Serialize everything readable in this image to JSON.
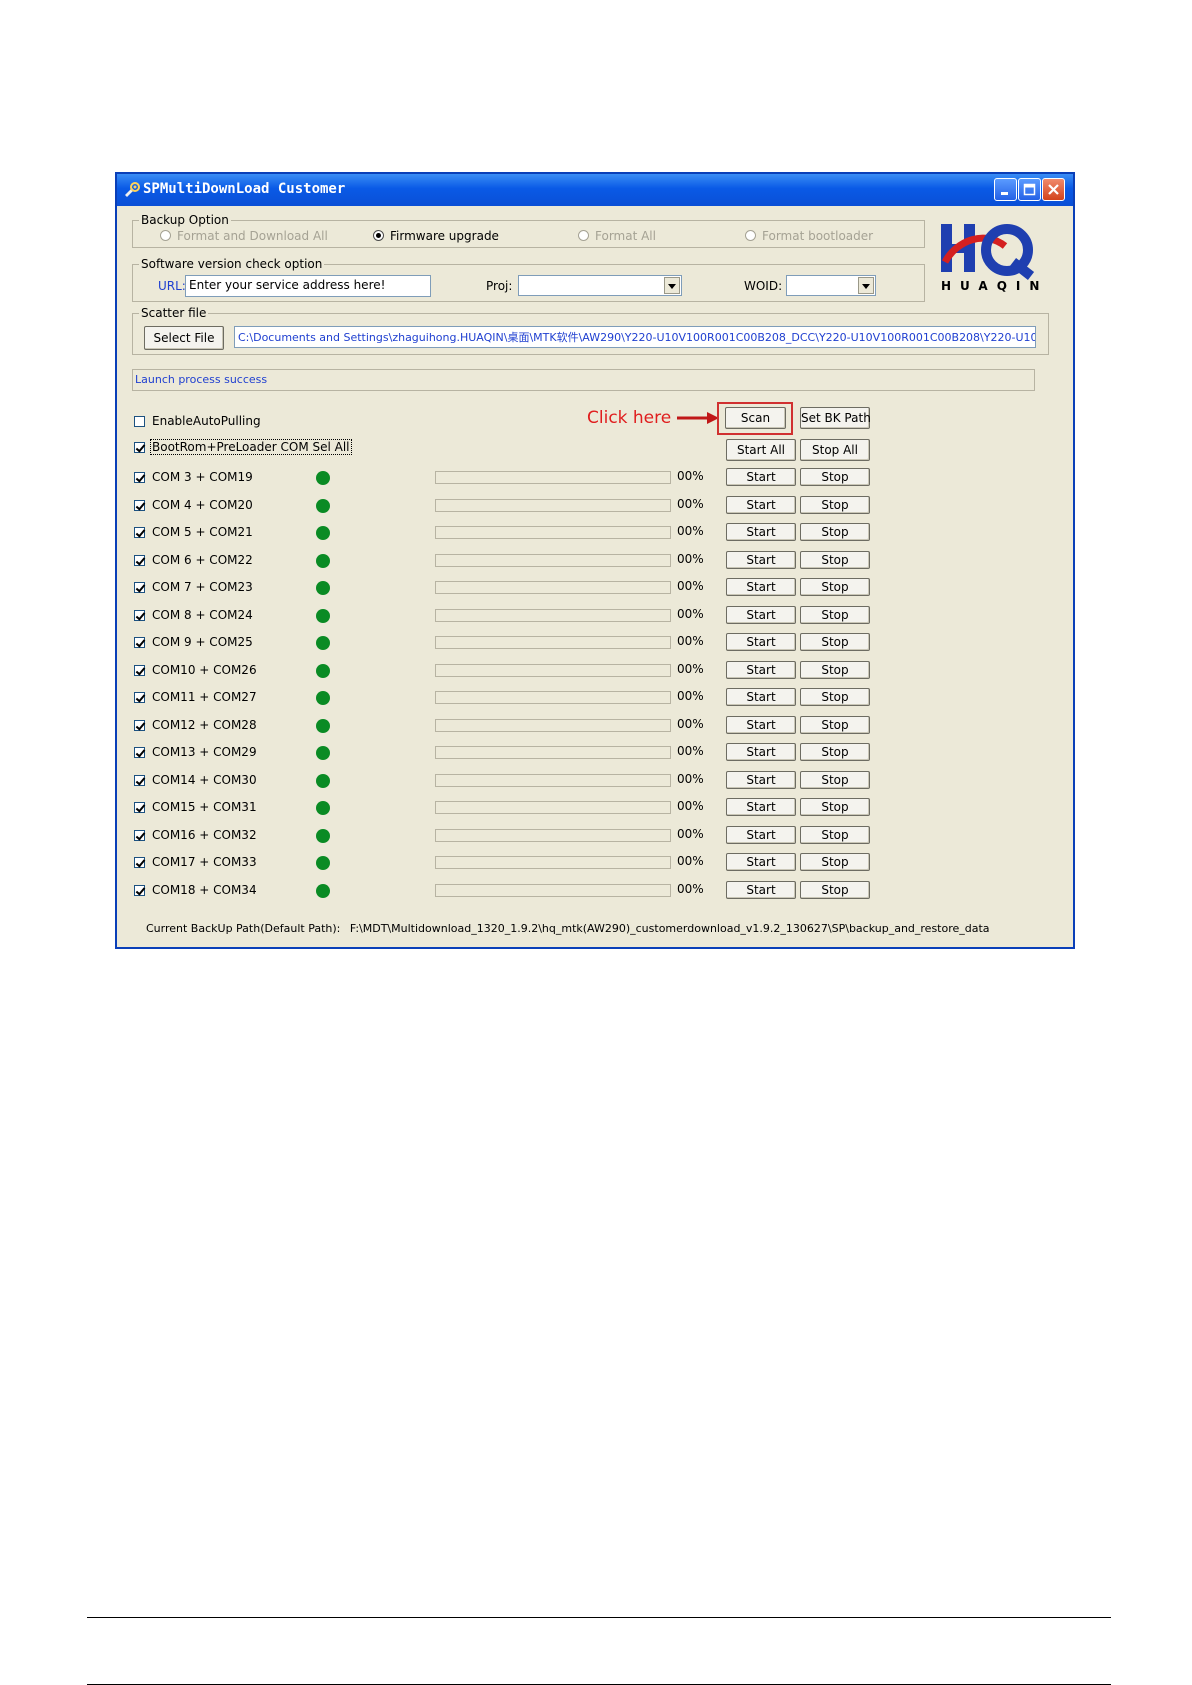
{
  "window": {
    "title": "SPMultiDownLoad Customer"
  },
  "backup_option": {
    "legend": "Backup Option",
    "options": [
      {
        "label": "Format and Download All",
        "selected": false,
        "enabled": false
      },
      {
        "label": "Firmware upgrade",
        "selected": true,
        "enabled": true
      },
      {
        "label": "Format All",
        "selected": false,
        "enabled": false
      },
      {
        "label": "Format bootloader",
        "selected": false,
        "enabled": false
      }
    ]
  },
  "version_check": {
    "legend": "Software version check option",
    "url_label": "URL:",
    "url_value": "Enter your service address here!",
    "proj_label": "Proj:",
    "proj_value": "",
    "woid_label": "WOID:",
    "woid_value": ""
  },
  "logo": {
    "letters": "HQ",
    "wordmark": "HUAQIN",
    "colors": {
      "blue": "#1f3fb0",
      "red": "#d42020"
    }
  },
  "scatter": {
    "legend": "Scatter file",
    "select_button": "Select File",
    "path": "C:\\Documents and Settings\\zhaguihong.HUAQIN\\桌面\\MTK软件\\AW290\\Y220-U10V100R001C00B208_DCC\\Y220-U10V100R001C00B208\\Y220-U10V1"
  },
  "status_text": "Launch process success",
  "controls": {
    "auto_pulling_label": "EnableAutoPulling",
    "auto_pulling_checked": false,
    "sel_all_label": "BootRom+PreLoader COM Sel All",
    "sel_all_checked": true,
    "click_here": "Click here",
    "scan_button": "Scan",
    "set_bk_path_button": "Set BK Path",
    "start_all_button": "Start All",
    "stop_all_button": "Stop All"
  },
  "ports": [
    {
      "label": "COM 3 + COM19",
      "percent": "00%",
      "progress": 0,
      "checked": true
    },
    {
      "label": "COM 4 + COM20",
      "percent": "00%",
      "progress": 0,
      "checked": true
    },
    {
      "label": "COM 5 + COM21",
      "percent": "00%",
      "progress": 0,
      "checked": true
    },
    {
      "label": "COM 6 + COM22",
      "percent": "00%",
      "progress": 0,
      "checked": true
    },
    {
      "label": "COM 7 + COM23",
      "percent": "00%",
      "progress": 0,
      "checked": true
    },
    {
      "label": "COM 8 + COM24",
      "percent": "00%",
      "progress": 0,
      "checked": true
    },
    {
      "label": "COM 9 + COM25",
      "percent": "00%",
      "progress": 0,
      "checked": true
    },
    {
      "label": "COM10 + COM26",
      "percent": "00%",
      "progress": 0,
      "checked": true
    },
    {
      "label": "COM11 + COM27",
      "percent": "00%",
      "progress": 0,
      "checked": true
    },
    {
      "label": "COM12 + COM28",
      "percent": "00%",
      "progress": 0,
      "checked": true
    },
    {
      "label": "COM13 + COM29",
      "percent": "00%",
      "progress": 0,
      "checked": true
    },
    {
      "label": "COM14 + COM30",
      "percent": "00%",
      "progress": 0,
      "checked": true
    },
    {
      "label": "COM15 + COM31",
      "percent": "00%",
      "progress": 0,
      "checked": true
    },
    {
      "label": "COM16 + COM32",
      "percent": "00%",
      "progress": 0,
      "checked": true
    },
    {
      "label": "COM17 + COM33",
      "percent": "00%",
      "progress": 0,
      "checked": true
    },
    {
      "label": "COM18 + COM34",
      "percent": "00%",
      "progress": 0,
      "checked": true
    }
  ],
  "row_buttons": {
    "start": "Start",
    "stop": "Stop"
  },
  "status_dot_color": "#0a8b24",
  "footer": {
    "label": "Current BackUp Path(Default Path):",
    "path": "F:\\MDT\\Multidownload_1320_1.9.2\\hq_mtk(AW290)_customerdownload_v1.9.2_130627\\SP\\backup_and_restore_data"
  }
}
